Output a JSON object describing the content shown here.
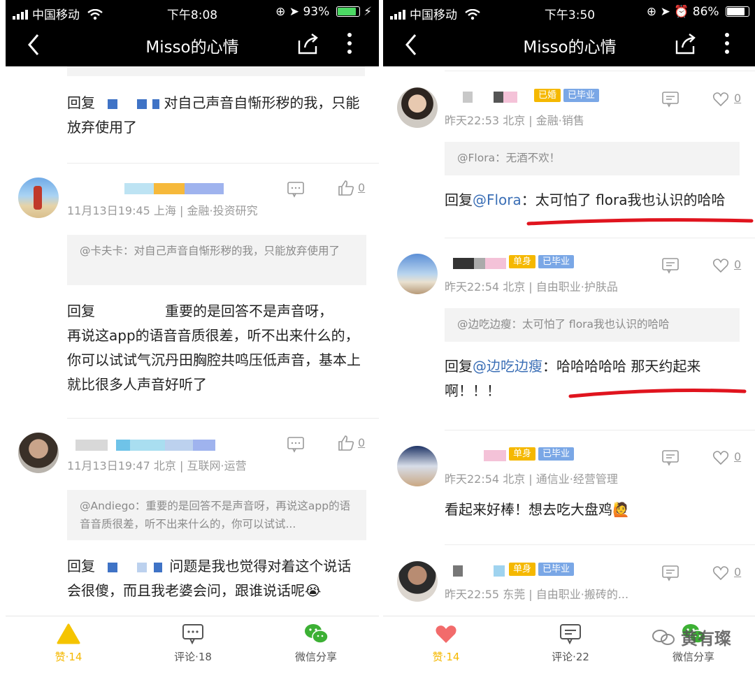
{
  "left": {
    "status": {
      "carrier": "中国移动",
      "time": "下午8:08",
      "battery": "93%",
      "battery_color": "#4cd964"
    },
    "title": "Misso的心情",
    "comments": [
      {
        "body_prefix": "回复",
        "body": "对自己声音自惭形秽的我，只能放弃使用了"
      },
      {
        "meta": "11月13日19:45 上海 | 金融·投资研究",
        "like_count": "0",
        "quote": "@卡夫卡：对自己声音自惭形秽的我，只能放弃使用了",
        "body_prefix": "回复",
        "body_line1": "重要的是回答不是声音呀，",
        "body_rest": "再说这app的语音音质很差，听不出来什么的，你可以试试气沉丹田胸腔共鸣压低声音，基本上就比很多人声音好听了"
      },
      {
        "meta": "11月13日19:47 北京 | 互联网·运营",
        "like_count": "0",
        "quote": "@Andiego：重要的是回答不是声音呀，再说这app的语音音质很差，听不出来什么的，你可以试试...",
        "body_prefix": "回复",
        "body": "问题是我也觉得对着这个说话会很傻，而且我老婆会问，跟谁说话呢😭"
      }
    ],
    "bottom": {
      "like": "赞·14",
      "comment": "评论·18",
      "share": "微信分享"
    }
  },
  "right": {
    "status": {
      "carrier": "中国移动",
      "time": "下午3:50",
      "battery": "86%",
      "battery_color": "#ffffff"
    },
    "title": "Misso的心情",
    "comments": [
      {
        "tags": [
          "已婚",
          "已毕业"
        ],
        "meta": "昨天22:53 北京 | 金融·销售",
        "like_count": "0",
        "quote": "@Flora：无酒不欢！",
        "body_prefix": "回复",
        "mention": "@Flora",
        "body": "：太可怕了 flora我也认识的哈哈"
      },
      {
        "tags": [
          "单身",
          "已毕业"
        ],
        "meta": "昨天22:54 北京 | 自由职业·护肤品",
        "like_count": "0",
        "quote": "@边吃边瘦：太可怕了 flora我也认识的哈哈",
        "body_prefix": "回复",
        "mention": "@边吃边瘦",
        "body": "：哈哈哈哈哈 那天约起来啊！！！"
      },
      {
        "tags": [
          "单身",
          "已毕业"
        ],
        "meta": "昨天22:54 北京 | 通信业·经营管理",
        "like_count": "0",
        "body": "看起来好棒！想去吃大盘鸡🙋"
      },
      {
        "tags": [
          "单身",
          "已毕业"
        ],
        "meta": "昨天22:55 东莞 | 自由职业·搬砖的...",
        "like_count": "0"
      }
    ],
    "bottom": {
      "like": "赞·14",
      "comment": "评论·22",
      "share": "微信分享"
    },
    "watermark": "黄有璨"
  },
  "colors": {
    "accent_yellow": "#f5b800",
    "heart_red": "#f26b6b",
    "tag_yellow": "#f5b800",
    "tag_blue": "#7aa7e6",
    "underline_red": "#e0141e",
    "link_blue": "#3b6fb6"
  }
}
